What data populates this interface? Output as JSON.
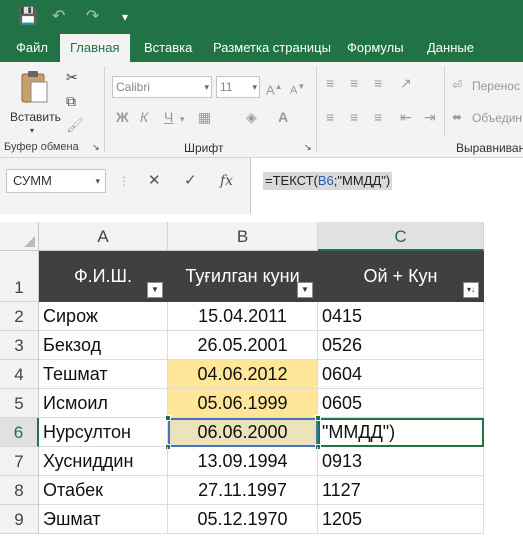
{
  "quick_access": {
    "save_icon": "💾",
    "undo_icon": "↶",
    "redo_icon": "↷",
    "customize_icon": "▾"
  },
  "tabs": [
    "Файл",
    "Главная",
    "Вставка",
    "Разметка страницы",
    "Формулы",
    "Данные"
  ],
  "active_tab": "Главная",
  "ribbon": {
    "paste_label": "Вставить",
    "clipboard_group": "Буфер обмена",
    "font_group": "Шрифт",
    "alignment_group": "Выравнивани",
    "font_name": "Calibri",
    "font_size": "11",
    "bold": "Ж",
    "italic": "К",
    "underline": "Ч",
    "wrap_text": "Перенос",
    "merge": "Объедин"
  },
  "formula_bar": {
    "name_box": "СУММ",
    "cancel": "✕",
    "enter": "✓",
    "fx": "fx",
    "formula_prefix": "=ТЕКСТ(",
    "formula_ref": "B6",
    "formula_suffix": ";\"ММДД\")"
  },
  "columns": [
    "A",
    "B",
    "C"
  ],
  "rows": [
    "1",
    "2",
    "3",
    "4",
    "5",
    "6",
    "7",
    "8",
    "9"
  ],
  "headers": [
    "Ф.И.Ш.",
    "Туғилган куни",
    "Ой + Кун"
  ],
  "data_rows": [
    {
      "name": "Сирож",
      "date": "15.04.2011",
      "mmdd": "0415"
    },
    {
      "name": "Бекзод",
      "date": "26.05.2001",
      "mmdd": "0526"
    },
    {
      "name": "Тешмат",
      "date": "04.06.2012",
      "mmdd": "0604"
    },
    {
      "name": "Исмоил",
      "date": "05.06.1999",
      "mmdd": "0605"
    },
    {
      "name": "Нурсултон",
      "date": "06.06.2000",
      "mmdd": "\"ММДД\")"
    },
    {
      "name": "Хусниддин",
      "date": "13.09.1994",
      "mmdd": "0913"
    },
    {
      "name": "Отабек",
      "date": "27.11.1997",
      "mmdd": "1127"
    },
    {
      "name": "Эшмат",
      "date": "05.12.1970",
      "mmdd": "1205"
    }
  ],
  "colors": {
    "accent": "#217346",
    "header_fill": "#404040",
    "highlight": "#ffe699",
    "ref_border": "#4472c4"
  }
}
